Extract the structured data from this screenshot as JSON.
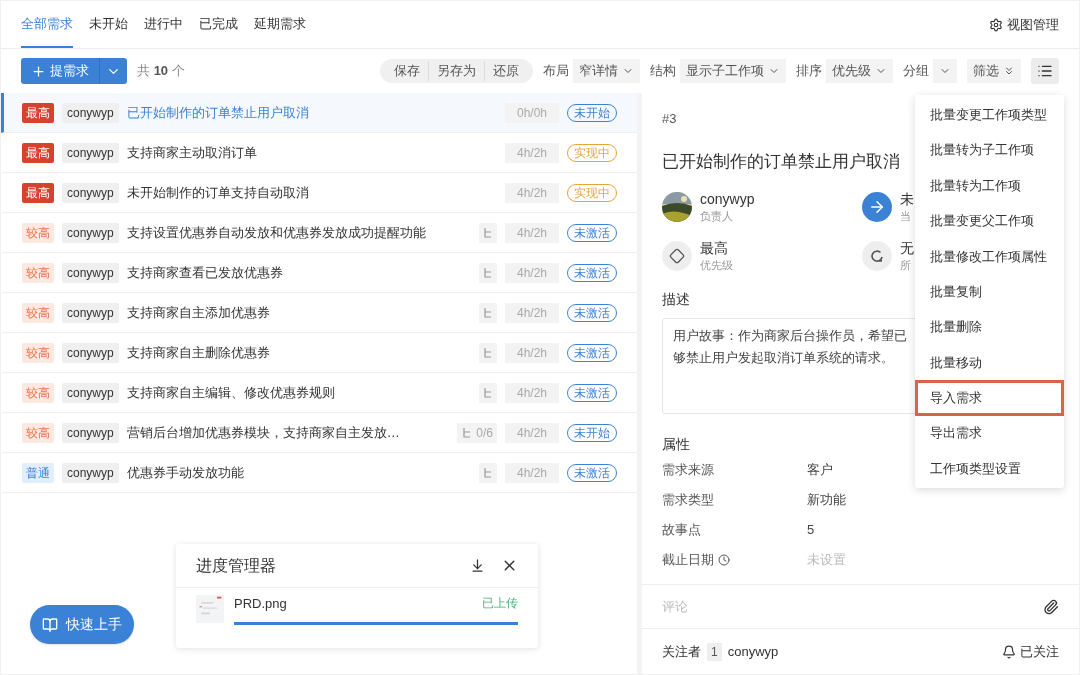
{
  "tabs": [
    {
      "label": "全部需求",
      "selected": true
    },
    {
      "label": "未开始",
      "selected": false
    },
    {
      "label": "进行中",
      "selected": false
    },
    {
      "label": "已完成",
      "selected": false
    },
    {
      "label": "延期需求",
      "selected": false
    }
  ],
  "view_manage": "视图管理",
  "toolbar": {
    "create": "提需求",
    "count_prefix": "共",
    "count": "10",
    "count_suffix": "个",
    "view_actions": [
      "保存",
      "另存为",
      "还原"
    ],
    "selects": [
      {
        "label": "布局",
        "value": "窄详情"
      },
      {
        "label": "结构",
        "value": "显示子工作项"
      },
      {
        "label": "排序",
        "value": "优先级"
      },
      {
        "label": "分组"
      }
    ],
    "filter": "筛选"
  },
  "rows": [
    {
      "priority": "最高",
      "kind": "highest",
      "owner": "conywyp",
      "title": "已开始制作的订单禁止用户取消",
      "subtasks": false,
      "time": "0h/0h",
      "status": "未开始",
      "color": "#3b82d6",
      "selected": true
    },
    {
      "priority": "最高",
      "kind": "highest",
      "owner": "conywyp",
      "title": "支持商家主动取消订单",
      "subtasks": false,
      "time": "4h/2h",
      "status": "实现中",
      "color": "#e8a33d",
      "selected": false
    },
    {
      "priority": "最高",
      "kind": "highest",
      "owner": "conywyp",
      "title": "未开始制作的订单支持自动取消",
      "subtasks": false,
      "time": "4h/2h",
      "status": "实现中",
      "color": "#e8a33d",
      "selected": false
    },
    {
      "priority": "较高",
      "kind": "high",
      "owner": "conywyp",
      "title": "支持设置优惠券自动发放和优惠券发放成功提醒功能",
      "subtasks": true,
      "time": "4h/2h",
      "status": "未激活",
      "color": "#3b82d6",
      "selected": false
    },
    {
      "priority": "较高",
      "kind": "high",
      "owner": "conywyp",
      "title": "支持商家查看已发放优惠券",
      "subtasks": true,
      "time": "4h/2h",
      "status": "未激活",
      "color": "#3b82d6",
      "selected": false
    },
    {
      "priority": "较高",
      "kind": "high",
      "owner": "conywyp",
      "title": "支持商家自主添加优惠券",
      "subtasks": true,
      "time": "4h/2h",
      "status": "未激活",
      "color": "#3b82d6",
      "selected": false
    },
    {
      "priority": "较高",
      "kind": "high",
      "owner": "conywyp",
      "title": "支持商家自主删除优惠券",
      "subtasks": true,
      "time": "4h/2h",
      "status": "未激活",
      "color": "#3b82d6",
      "selected": false
    },
    {
      "priority": "较高",
      "kind": "high",
      "owner": "conywyp",
      "title": "支持商家自主编辑、修改优惠券规则",
      "subtasks": true,
      "time": "4h/2h",
      "status": "未激活",
      "color": "#3b82d6",
      "selected": false
    },
    {
      "priority": "较高",
      "kind": "high",
      "owner": "conywyp",
      "title": "营销后台增加优惠券模块，支持商家自主发放…",
      "subtasks": true,
      "subtask_count": "0/6",
      "time": "4h/2h",
      "status": "未开始",
      "color": "#3b82d6",
      "selected": false
    },
    {
      "priority": "普通",
      "kind": "normal",
      "owner": "conywyp",
      "title": "优惠券手动发放功能",
      "subtasks": true,
      "time": "4h/2h",
      "status": "未激活",
      "color": "#3b82d6",
      "selected": false
    }
  ],
  "quick_start": "快速上手",
  "progress_manager": {
    "title": "进度管理器",
    "file": {
      "kind": "picture",
      "name": "PRD.png",
      "state": "已上传",
      "level": 1
    }
  },
  "detail": {
    "number": "#3",
    "title": "已开始制作的订单禁止用户取消",
    "fields": [
      {
        "kind": "avatar",
        "value": "conywyp",
        "label": "负责人"
      },
      {
        "kind": "state",
        "value": "未",
        "label": "当"
      },
      {
        "kind": "priority",
        "value": "最高",
        "label": "优先级"
      },
      {
        "kind": "sprint",
        "value": "无",
        "label": "所"
      }
    ],
    "description_heading": "描述",
    "description": [
      "用户故事：作为商家后台操作员，希望已",
      "够禁止用户发起取消订单系统的请求。"
    ],
    "attributes_heading": "属性",
    "attributes": [
      {
        "label": "需求来源",
        "value": "客户",
        "empty": false,
        "clock": false
      },
      {
        "label": "需求类型",
        "value": "新功能",
        "empty": false,
        "clock": false
      },
      {
        "label": "故事点",
        "value": "5",
        "empty": false,
        "clock": false
      },
      {
        "label": "截止日期",
        "value": "未设置",
        "empty": true,
        "clock": true
      }
    ],
    "comment_placeholder": "评论",
    "watchers_label": "关注者",
    "watchers_count": "1",
    "watcher": "conywyp",
    "follow": "已关注"
  },
  "menu": [
    {
      "label": "批量变更工作项类型",
      "selected": false
    },
    {
      "label": "批量转为子工作项",
      "selected": false
    },
    {
      "label": "批量转为工作项",
      "selected": false
    },
    {
      "label": "批量变更父工作项",
      "selected": false
    },
    {
      "label": "批量修改工作项属性",
      "selected": false
    },
    {
      "label": "批量复制",
      "selected": false
    },
    {
      "label": "批量删除",
      "selected": false
    },
    {
      "label": "批量移动",
      "selected": false
    },
    {
      "label": "导入需求",
      "selected": true
    },
    {
      "label": "导出需求",
      "selected": false
    },
    {
      "label": "工作项类型设置",
      "selected": false
    }
  ]
}
